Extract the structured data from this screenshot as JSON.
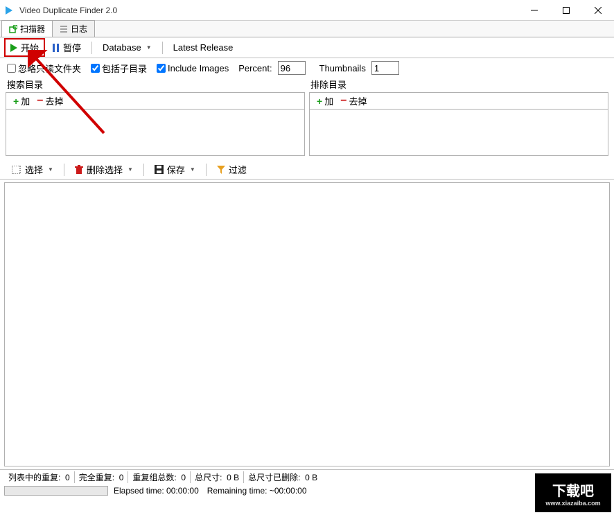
{
  "title": "Video Duplicate Finder 2.0",
  "tabs": {
    "scanner": "扫描器",
    "log": "日志"
  },
  "toolbar": {
    "start": "开始",
    "pause": "暂停",
    "database": "Database",
    "latest_release": "Latest Release"
  },
  "options": {
    "ignore_readonly": "忽略只读文件夹",
    "include_subdir": "包括子目录",
    "include_images": "Include Images",
    "percent_label": "Percent:",
    "percent_value": "96",
    "thumbnails_label": "Thumbnails",
    "thumbnails_value": "1"
  },
  "groups": {
    "search": {
      "title": "搜索目录",
      "add": "加",
      "remove": "去掉"
    },
    "exclude": {
      "title": "排除目录",
      "add": "加",
      "remove": "去掉"
    }
  },
  "toolbar2": {
    "select": "选择",
    "delete_select": "删除选择",
    "save": "保存",
    "filter": "过滤"
  },
  "status": {
    "dup_in_list_label": "列表中的重复:",
    "dup_in_list_value": "0",
    "full_dup_label": "完全重复:",
    "full_dup_value": "0",
    "dup_groups_label": "重复组总数:",
    "dup_groups_value": "0",
    "total_size_label": "总尺寸:",
    "total_size_value": "0 B",
    "deleted_size_label": "总尺寸已删除:",
    "deleted_size_value": "0 B",
    "elapsed_label": "Elapsed time:",
    "elapsed_value": "00:00:00",
    "remaining_label": "Remaining time:",
    "remaining_value": "~00:00:00"
  },
  "watermark": {
    "text": "下载吧",
    "url": "www.xiazaiba.com"
  }
}
